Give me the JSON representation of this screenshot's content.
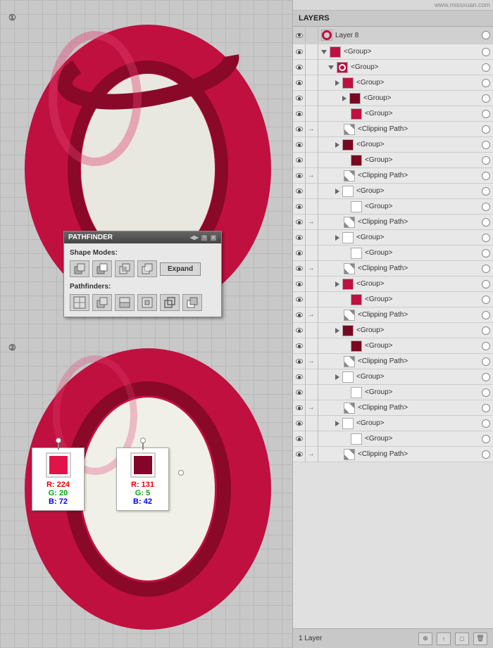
{
  "canvas": {
    "step1_label": "①",
    "step2_label": "②"
  },
  "pathfinder": {
    "title": "PATHFINDER",
    "shape_modes_label": "Shape Modes:",
    "pathfinders_label": "Pathfinders:",
    "expand_button": "Expand",
    "resize_handle": "◀▶"
  },
  "color_box_1": {
    "r_label": "R: 224",
    "g_label": "G: 20",
    "b_label": "B: 72"
  },
  "color_box_2": {
    "r_label": "R: 131",
    "g_label": "G: 5",
    "b_label": "B: 42"
  },
  "layers": {
    "panel_title": "LAYERS",
    "watermark": "www.missxuan.com",
    "layer8_name": "Layer 8",
    "footer_layer_text": "1 Layer",
    "items": [
      {
        "id": 1,
        "name": "<Group>",
        "indent": 0,
        "has_triangle": true,
        "triangle_open": true,
        "thumb_type": "red-o",
        "arrow": false
      },
      {
        "id": 2,
        "name": "<Group>",
        "indent": 1,
        "has_triangle": true,
        "triangle_open": true,
        "thumb_type": "red-o",
        "arrow": false
      },
      {
        "id": 3,
        "name": "<Group>",
        "indent": 2,
        "has_triangle": true,
        "triangle_open": false,
        "thumb_type": "red-square",
        "arrow": false
      },
      {
        "id": 4,
        "name": "<Group>",
        "indent": 3,
        "has_triangle": true,
        "triangle_open": false,
        "thumb_type": "dark-square",
        "arrow": false
      },
      {
        "id": 5,
        "name": "<Group>",
        "indent": 3,
        "has_triangle": false,
        "triangle_open": false,
        "thumb_type": "red-square",
        "arrow": false
      },
      {
        "id": 6,
        "name": "<Clipping Path>",
        "indent": 3,
        "has_triangle": false,
        "triangle_open": false,
        "thumb_type": "clip",
        "arrow": true
      },
      {
        "id": 7,
        "name": "<Group>",
        "indent": 2,
        "has_triangle": true,
        "triangle_open": false,
        "thumb_type": "dark-square",
        "arrow": false
      },
      {
        "id": 8,
        "name": "<Group>",
        "indent": 3,
        "has_triangle": false,
        "triangle_open": false,
        "thumb_type": "dark-square",
        "arrow": false
      },
      {
        "id": 9,
        "name": "<Clipping Path>",
        "indent": 3,
        "has_triangle": false,
        "triangle_open": false,
        "thumb_type": "clip",
        "arrow": true
      },
      {
        "id": 10,
        "name": "<Group>",
        "indent": 2,
        "has_triangle": true,
        "triangle_open": false,
        "thumb_type": "white",
        "arrow": false
      },
      {
        "id": 11,
        "name": "<Group>",
        "indent": 3,
        "has_triangle": false,
        "triangle_open": false,
        "thumb_type": "white",
        "arrow": false
      },
      {
        "id": 12,
        "name": "<Clipping Path>",
        "indent": 3,
        "has_triangle": false,
        "triangle_open": false,
        "thumb_type": "clip",
        "arrow": true
      },
      {
        "id": 13,
        "name": "<Group>",
        "indent": 2,
        "has_triangle": true,
        "triangle_open": false,
        "thumb_type": "white",
        "arrow": false
      },
      {
        "id": 14,
        "name": "<Group>",
        "indent": 3,
        "has_triangle": false,
        "triangle_open": false,
        "thumb_type": "white",
        "arrow": false
      },
      {
        "id": 15,
        "name": "<Clipping Path>",
        "indent": 3,
        "has_triangle": false,
        "triangle_open": false,
        "thumb_type": "clip",
        "arrow": true
      },
      {
        "id": 16,
        "name": "<Group>",
        "indent": 2,
        "has_triangle": true,
        "triangle_open": false,
        "thumb_type": "red-square",
        "arrow": false
      },
      {
        "id": 17,
        "name": "<Group>",
        "indent": 3,
        "has_triangle": false,
        "triangle_open": false,
        "thumb_type": "red-square",
        "arrow": false
      },
      {
        "id": 18,
        "name": "<Clipping Path>",
        "indent": 3,
        "has_triangle": false,
        "triangle_open": false,
        "thumb_type": "clip",
        "arrow": true
      },
      {
        "id": 19,
        "name": "<Group>",
        "indent": 2,
        "has_triangle": true,
        "triangle_open": false,
        "thumb_type": "dark-square",
        "arrow": false
      },
      {
        "id": 20,
        "name": "<Group>",
        "indent": 3,
        "has_triangle": false,
        "triangle_open": false,
        "thumb_type": "dark-square",
        "arrow": false
      },
      {
        "id": 21,
        "name": "<Clipping Path>",
        "indent": 3,
        "has_triangle": false,
        "triangle_open": false,
        "thumb_type": "clip",
        "arrow": true
      },
      {
        "id": 22,
        "name": "<Group>",
        "indent": 2,
        "has_triangle": true,
        "triangle_open": false,
        "thumb_type": "white",
        "arrow": false
      },
      {
        "id": 23,
        "name": "<Group>",
        "indent": 3,
        "has_triangle": false,
        "triangle_open": false,
        "thumb_type": "white",
        "arrow": false
      },
      {
        "id": 24,
        "name": "<Clipping Path>",
        "indent": 3,
        "has_triangle": false,
        "triangle_open": false,
        "thumb_type": "clip",
        "arrow": true
      },
      {
        "id": 25,
        "name": "<Group>",
        "indent": 2,
        "has_triangle": true,
        "triangle_open": false,
        "thumb_type": "white",
        "arrow": false
      },
      {
        "id": 26,
        "name": "<Group>",
        "indent": 3,
        "has_triangle": false,
        "triangle_open": false,
        "thumb_type": "white",
        "arrow": false
      },
      {
        "id": 27,
        "name": "<Clipping Path>",
        "indent": 3,
        "has_triangle": false,
        "triangle_open": false,
        "thumb_type": "clip",
        "arrow": true
      }
    ]
  }
}
